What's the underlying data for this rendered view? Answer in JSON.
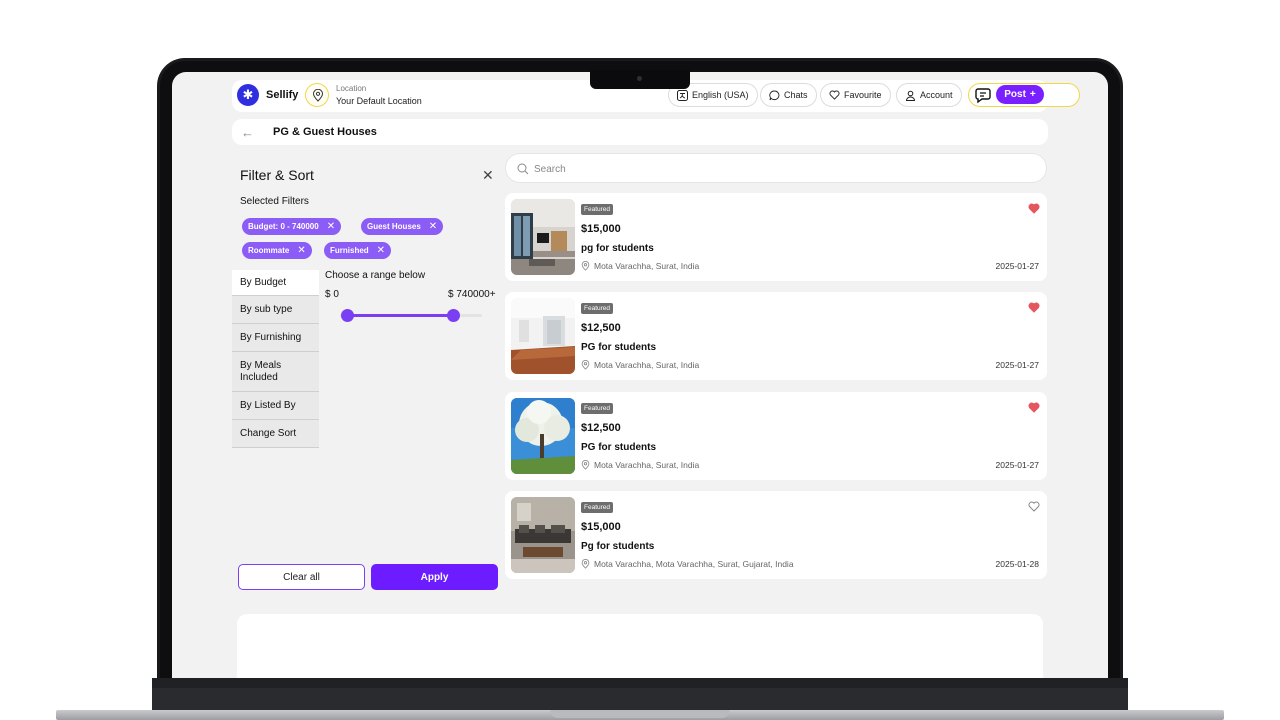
{
  "header": {
    "logo_glyph": "✱",
    "brand": "Sellify",
    "location_label": "Location",
    "location_value": "Your Default Location",
    "language": "English (USA)",
    "chats": "Chats",
    "favourite": "Favourite",
    "account": "Account",
    "post": "Post",
    "post_plus": "+"
  },
  "breadcrumb": {
    "back_glyph": "←",
    "title": "PG & Guest Houses"
  },
  "filter": {
    "title": "Filter & Sort",
    "close_glyph": "✕",
    "selected_label": "Selected Filters",
    "chips": [
      {
        "label": "Budget: 0 - 740000",
        "x": "✕"
      },
      {
        "label": "Guest Houses",
        "x": "✕"
      },
      {
        "label": "Roommate",
        "x": "✕"
      },
      {
        "label": "Furnished",
        "x": "✕"
      }
    ],
    "tabs": [
      {
        "label": "By Budget"
      },
      {
        "label": "By sub type"
      },
      {
        "label": "By Furnishing"
      },
      {
        "label": "By Meals Included"
      },
      {
        "label": "By Listed By"
      },
      {
        "label": "Change Sort"
      }
    ],
    "range_label": "Choose a range below",
    "range_min": "$ 0",
    "range_max": "$ 740000+",
    "slider_low": 0.05,
    "slider_high": 0.8,
    "clear_label": "Clear all",
    "apply_label": "Apply"
  },
  "search": {
    "placeholder": "Search"
  },
  "listings": [
    {
      "badge": "Featured",
      "price": "$15,000",
      "title": "pg for students",
      "location": "Mota Varachha, Surat, India",
      "date": "2025-01-27",
      "favourited": true
    },
    {
      "badge": "Featured",
      "price": "$12,500",
      "title": "PG for students",
      "location": "Mota Varachha, Surat, India",
      "date": "2025-01-27",
      "favourited": true
    },
    {
      "badge": "Featured",
      "price": "$12,500",
      "title": "PG for students",
      "location": "Mota Varachha, Surat, India",
      "date": "2025-01-27",
      "favourited": true
    },
    {
      "badge": "Featured",
      "price": "$15,000",
      "title": "Pg for students",
      "location": "Mota Varachha, Mota Varachha, Surat, Gujarat, India",
      "date": "2025-01-28",
      "favourited": false
    }
  ],
  "colors": {
    "accent": "#6c1cff",
    "chip": "#8b5cf6",
    "heart_active": "#e4575f"
  }
}
